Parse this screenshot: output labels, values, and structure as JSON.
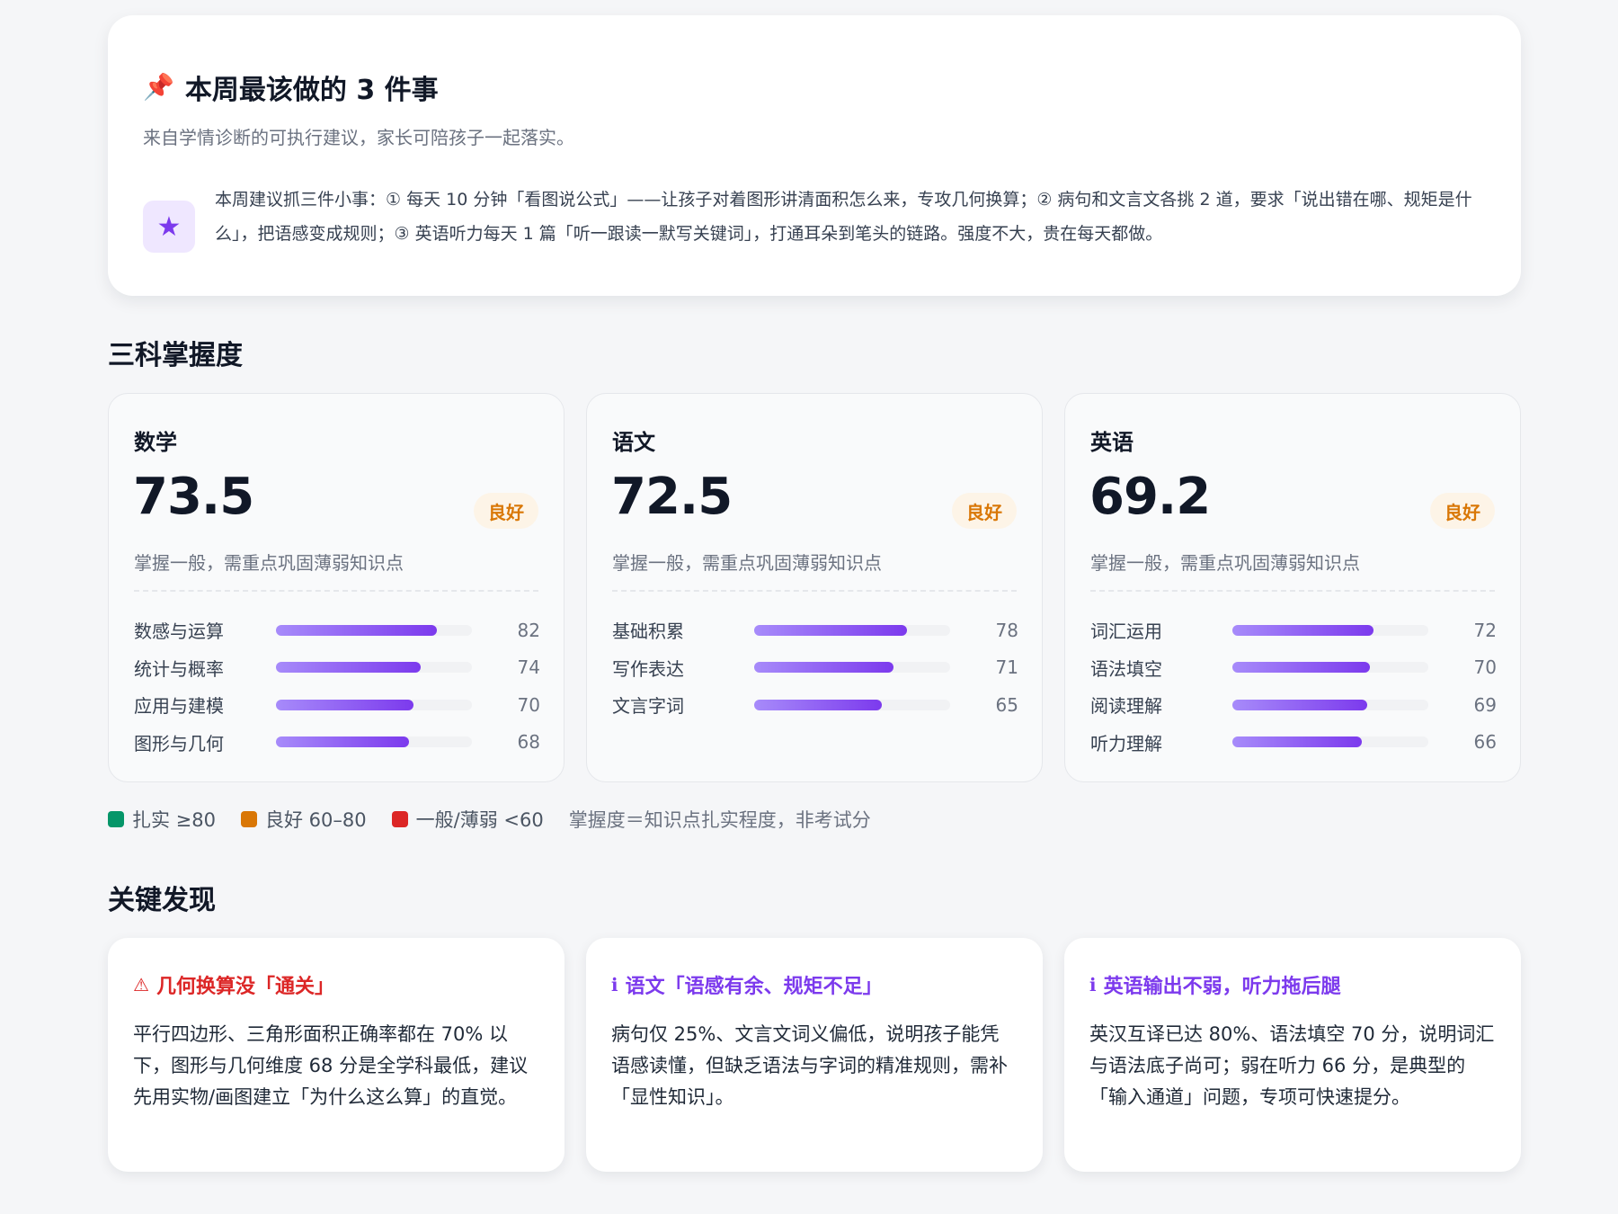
{
  "colors": {
    "accent": "#7c3aed",
    "good": "#d97706",
    "solid": "#059669",
    "weak": "#dc2626"
  },
  "top": {
    "title": "本周最该做的 3 件事",
    "title_icon": "pushpin-icon",
    "subtitle": "来自学情诊断的可执行建议，家长可陪孩子一起落实。",
    "tip_icon": "star-icon",
    "tip": "本周建议抓三件小事：① 每天 10 分钟「看图说公式」——让孩子对着图形讲清面积怎么来，专攻几何换算；② 病句和文言文各挑 2 道，要求「说出错在哪、规矩是什么」，把语感变成规则；③ 英语听力每天 1 篇「听一跟读一默写关键词」，打通耳朵到笔头的链路。强度不大，贵在每天都做。"
  },
  "mastery": {
    "title": "三科掌握度",
    "subjects": [
      {
        "name": "数学",
        "score": "73.5",
        "badge": "良好",
        "note": "掌握一般，需重点巩固薄弱知识点",
        "skills": [
          {
            "label": "数感与运算",
            "value": 82
          },
          {
            "label": "统计与概率",
            "value": 74
          },
          {
            "label": "应用与建模",
            "value": 70
          },
          {
            "label": "图形与几何",
            "value": 68
          }
        ]
      },
      {
        "name": "语文",
        "score": "72.5",
        "badge": "良好",
        "note": "掌握一般，需重点巩固薄弱知识点",
        "skills": [
          {
            "label": "基础积累",
            "value": 78
          },
          {
            "label": "写作表达",
            "value": 71
          },
          {
            "label": "文言字词",
            "value": 65
          }
        ]
      },
      {
        "name": "英语",
        "score": "69.2",
        "badge": "良好",
        "note": "掌握一般，需重点巩固薄弱知识点",
        "skills": [
          {
            "label": "词汇运用",
            "value": 72
          },
          {
            "label": "语法填空",
            "value": 70
          },
          {
            "label": "阅读理解",
            "value": 69
          },
          {
            "label": "听力理解",
            "value": 66
          }
        ]
      }
    ],
    "legend": [
      {
        "label": "扎实 ≥80",
        "color": "#059669"
      },
      {
        "label": "良好 60–80",
        "color": "#d97706"
      },
      {
        "label": "一般/薄弱 <60",
        "color": "#dc2626"
      }
    ],
    "legend_note": "掌握度＝知识点扎实程度，非考试分"
  },
  "findings": {
    "title": "关键发现",
    "items": [
      {
        "icon": "warning-icon",
        "glyph": "⚠",
        "color": "#dc2626",
        "title": "几何换算没「通关」",
        "body": "平行四边形、三角形面积正确率都在 70% 以下，图形与几何维度 68 分是全学科最低，建议先用实物/画图建立「为什么这么算」的直觉。"
      },
      {
        "icon": "info-icon",
        "glyph": "ℹ",
        "color": "#7c3aed",
        "title": "语文「语感有余、规矩不足」",
        "body": "病句仅 25%、文言文词义偏低，说明孩子能凭语感读懂，但缺乏语法与字词的精准规则，需补「显性知识」。"
      },
      {
        "icon": "info-icon",
        "glyph": "ℹ",
        "color": "#7c3aed",
        "title": "英语输出不弱，听力拖后腿",
        "body": "英汉互译已达 80%、语法填空 70 分，说明词汇与语法底子尚可；弱在听力 66 分，是典型的「输入通道」问题，专项可快速提分。"
      }
    ]
  }
}
